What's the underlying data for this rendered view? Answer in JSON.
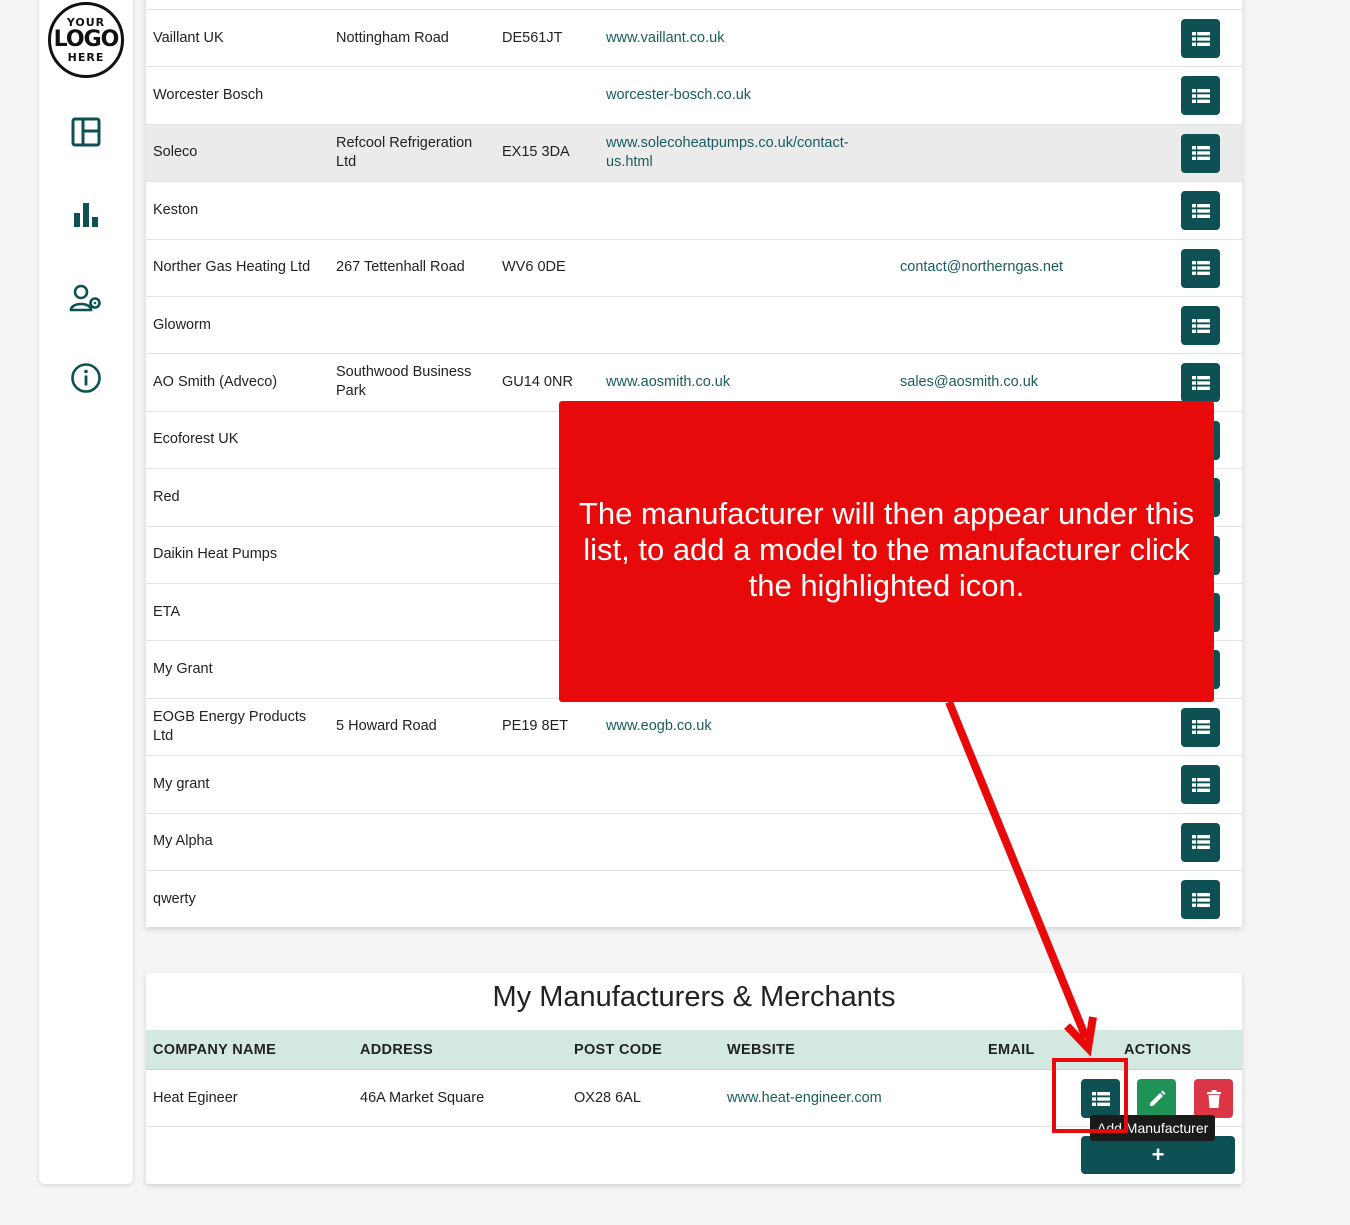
{
  "sidebar": {
    "logo": {
      "line1": "YOUR",
      "line2": "LOGO",
      "line3": "HERE"
    },
    "nav": [
      {
        "icon": "dashboard-icon"
      },
      {
        "icon": "bar-chart-icon"
      },
      {
        "icon": "user-settings-icon"
      },
      {
        "icon": "info-icon"
      }
    ]
  },
  "manufacturers": [
    {
      "name": "Vaillant UK",
      "address": "Nottingham Road",
      "postcode": "DE561JT",
      "website": "www.vaillant.co.uk",
      "email": ""
    },
    {
      "name": "Worcester Bosch",
      "address": "",
      "postcode": "",
      "website": "worcester-bosch.co.uk",
      "email": ""
    },
    {
      "name": "Soleco",
      "address": "Refcool Refrigeration Ltd",
      "postcode": "EX15 3DA",
      "website": "www.solecoheatpumps.co.uk/contact-us.html",
      "email": ""
    },
    {
      "name": "Keston",
      "address": "",
      "postcode": "",
      "website": "",
      "email": ""
    },
    {
      "name": "Norther Gas Heating Ltd",
      "address": "267 Tettenhall Road",
      "postcode": "WV6 0DE",
      "website": "",
      "email": "contact@northerngas.net"
    },
    {
      "name": "Gloworm",
      "address": "",
      "postcode": "",
      "website": "",
      "email": ""
    },
    {
      "name": "AO Smith (Adveco)",
      "address": "Southwood Business Park",
      "postcode": "GU14 0NR",
      "website": "www.aosmith.co.uk",
      "email": "sales@aosmith.co.uk"
    },
    {
      "name": "Ecoforest UK",
      "address": "",
      "postcode": "",
      "website": "",
      "email": ""
    },
    {
      "name": "Red",
      "address": "",
      "postcode": "",
      "website": "",
      "email": ""
    },
    {
      "name": "Daikin Heat Pumps",
      "address": "",
      "postcode": "",
      "website": "",
      "email": ""
    },
    {
      "name": "ETA",
      "address": "",
      "postcode": "",
      "website": "",
      "email": ""
    },
    {
      "name": "My Grant",
      "address": "",
      "postcode": "",
      "website": "",
      "email": ""
    },
    {
      "name": "EOGB Energy Products Ltd",
      "address": "5 Howard Road",
      "postcode": "PE19 8ET",
      "website": "www.eogb.co.uk",
      "email": ""
    },
    {
      "name": "My grant",
      "address": "",
      "postcode": "",
      "website": "",
      "email": ""
    },
    {
      "name": "My Alpha",
      "address": "",
      "postcode": "",
      "website": "",
      "email": ""
    },
    {
      "name": "qwerty",
      "address": "",
      "postcode": "",
      "website": "",
      "email": ""
    }
  ],
  "my_section": {
    "title": "My Manufacturers & Merchants",
    "headers": {
      "company": "COMPANY NAME",
      "address": "ADDRESS",
      "postcode": "POST CODE",
      "website": "WEBSITE",
      "email": "EMAIL",
      "actions": "ACTIONS"
    },
    "row": {
      "company": "Heat Egineer",
      "address": "46A Market Square",
      "postcode": "OX28 6AL",
      "website": "www.heat-engineer.com",
      "email": ""
    },
    "tooltip": "Add Manufacturer",
    "add_button_label": "+"
  },
  "callout": {
    "text": "The manufacturer will then appear under this list, to add a model to the manufacturer click the highlighted icon."
  },
  "colors": {
    "primary": "#0d5154",
    "edit": "#1f9256",
    "delete": "#dc3545",
    "callout": "#e80a0a",
    "link": "#1a5c5e",
    "table_header": "#d3e8de"
  }
}
